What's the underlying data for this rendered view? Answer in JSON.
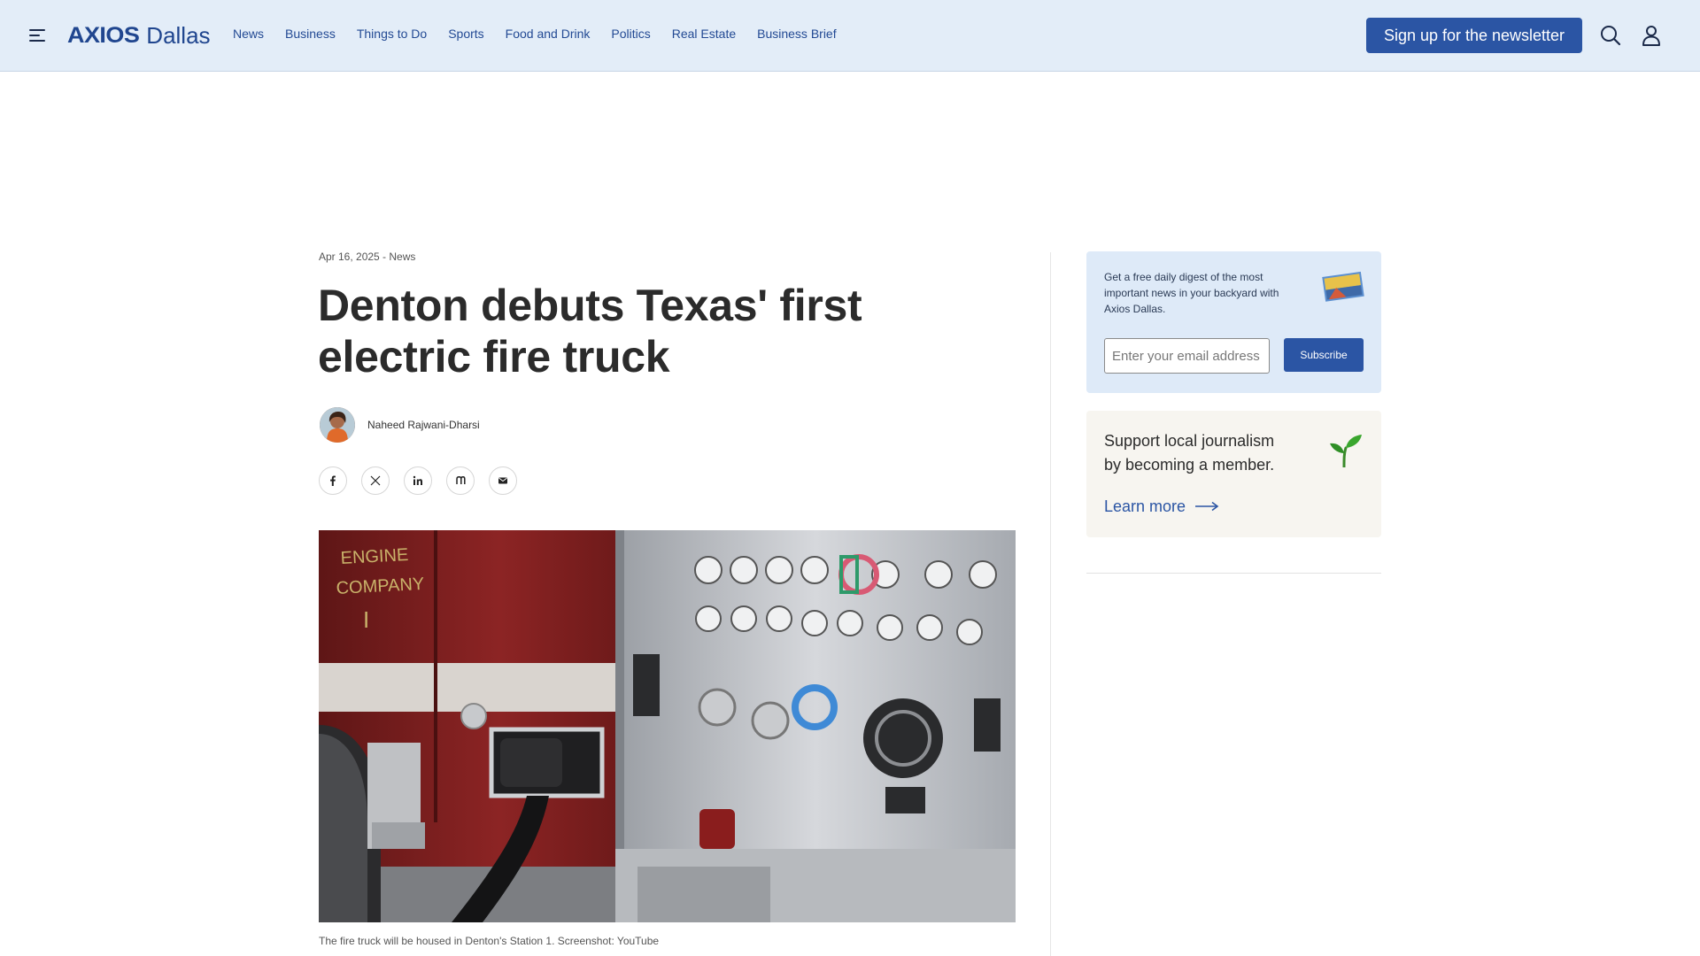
{
  "header": {
    "logo_brand": "AXIOS",
    "logo_city": "Dallas",
    "nav": [
      "News",
      "Business",
      "Things to Do",
      "Sports",
      "Food and Drink",
      "Politics",
      "Real Estate",
      "Business Brief"
    ],
    "signup_label": "Sign up for the newsletter",
    "icons": [
      "menu-icon",
      "search-icon",
      "user-icon"
    ]
  },
  "article": {
    "meta": "Apr 16, 2025 - News",
    "title": "Denton debuts Texas' first electric fire truck",
    "author": "Naheed Rajwani-Dharsi",
    "share": [
      "facebook-icon",
      "x-icon",
      "linkedin-icon",
      "threads-icon",
      "email-icon"
    ],
    "image_lettering": "ENGINE COMPANY I",
    "caption": "The fire truck will be housed in Denton's Station 1. Screenshot: YouTube"
  },
  "sidebar": {
    "newsletter": {
      "text": "Get a free daily digest of the most important news in your backyard with Axios Dallas.",
      "email_placeholder": "Enter your email address",
      "subscribe_label": "Subscribe"
    },
    "membership": {
      "text": "Support local journalism by becoming a member.",
      "link_label": "Learn more"
    }
  },
  "colors": {
    "header_bg": "#e3edf8",
    "brand_blue": "#2b55a4",
    "newsletter_bg": "#deeaf8",
    "member_bg": "#f7f5f0"
  }
}
